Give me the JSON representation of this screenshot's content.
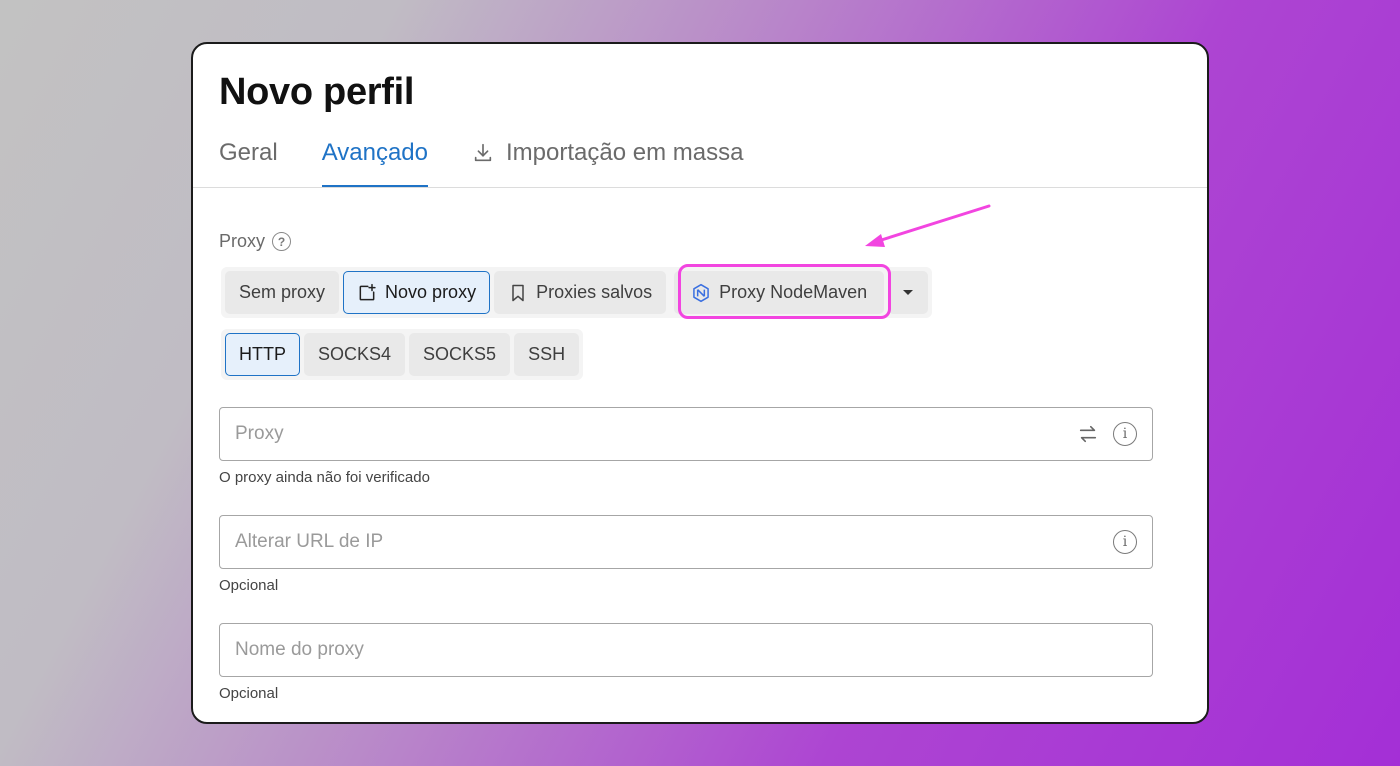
{
  "dialog": {
    "title": "Novo perfil"
  },
  "tabs": [
    {
      "label": "Geral"
    },
    {
      "label": "Avançado",
      "active": true
    },
    {
      "label": "Importação em massa",
      "icon": "download-icon"
    }
  ],
  "proxy": {
    "section_label": "Proxy",
    "mode_options": [
      {
        "label": "Sem proxy"
      },
      {
        "label": "Novo proxy",
        "icon": "new-item-icon",
        "selected": true
      },
      {
        "label": "Proxies salvos",
        "icon": "bookmark-icon"
      },
      {
        "label": "Proxy NodeMaven",
        "icon": "nodemaven-logo-icon"
      }
    ],
    "type_options": [
      {
        "label": "HTTP",
        "selected": true
      },
      {
        "label": "SOCKS4"
      },
      {
        "label": "SOCKS5"
      },
      {
        "label": "SSH"
      }
    ],
    "fields": [
      {
        "placeholder": "Proxy",
        "helper": "O proxy ainda não foi verificado",
        "icons": [
          "swap-icon",
          "info-icon"
        ]
      },
      {
        "placeholder": "Alterar URL de IP",
        "helper": "Opcional",
        "icons": [
          "info-icon"
        ]
      },
      {
        "placeholder": "Nome do proxy",
        "helper": "Opcional",
        "icons": []
      }
    ]
  },
  "colors": {
    "accent": "#1f73c6",
    "annotation": "#f245e0"
  }
}
